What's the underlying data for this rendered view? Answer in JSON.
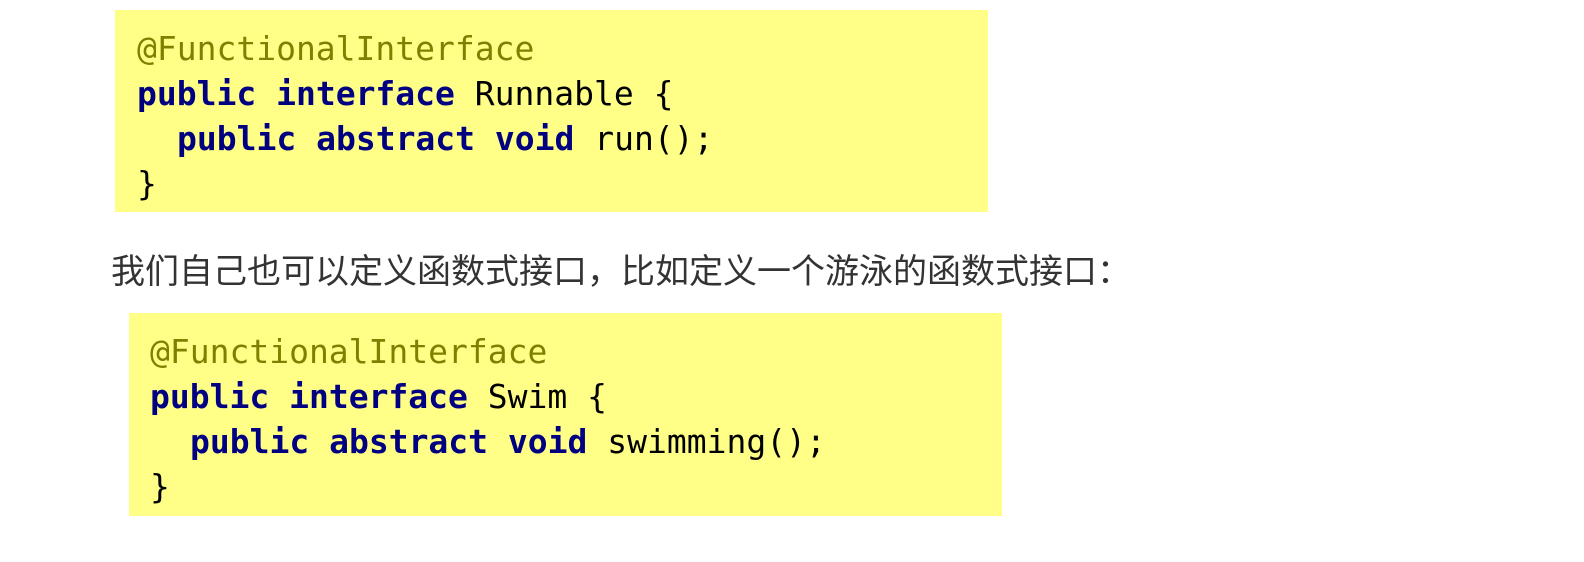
{
  "code_block_1": {
    "line1": {
      "annotation": "@FunctionalInterface"
    },
    "line2": {
      "kw1": "public",
      "kw2": "interface",
      "name": "Runnable",
      "brace": "{"
    },
    "line3": {
      "kw1": "public",
      "kw2": "abstract",
      "kw3": "void",
      "method": "run();"
    },
    "line4": {
      "brace": "}"
    }
  },
  "prose": {
    "text": "我们自己也可以定义函数式接口，比如定义一个游泳的函数式接口："
  },
  "code_block_2": {
    "line1": {
      "annotation": "@FunctionalInterface"
    },
    "line2": {
      "kw1": "public",
      "kw2": "interface",
      "name": "Swim",
      "brace": "{"
    },
    "line3": {
      "kw1": "public",
      "kw2": "abstract",
      "kw3": "void",
      "method": "swimming();"
    },
    "line4": {
      "brace": "}"
    }
  },
  "colors": {
    "code_background": "#ffff88",
    "annotation": "#808000",
    "keyword": "#000080",
    "text": "#000000",
    "prose": "#333333"
  }
}
